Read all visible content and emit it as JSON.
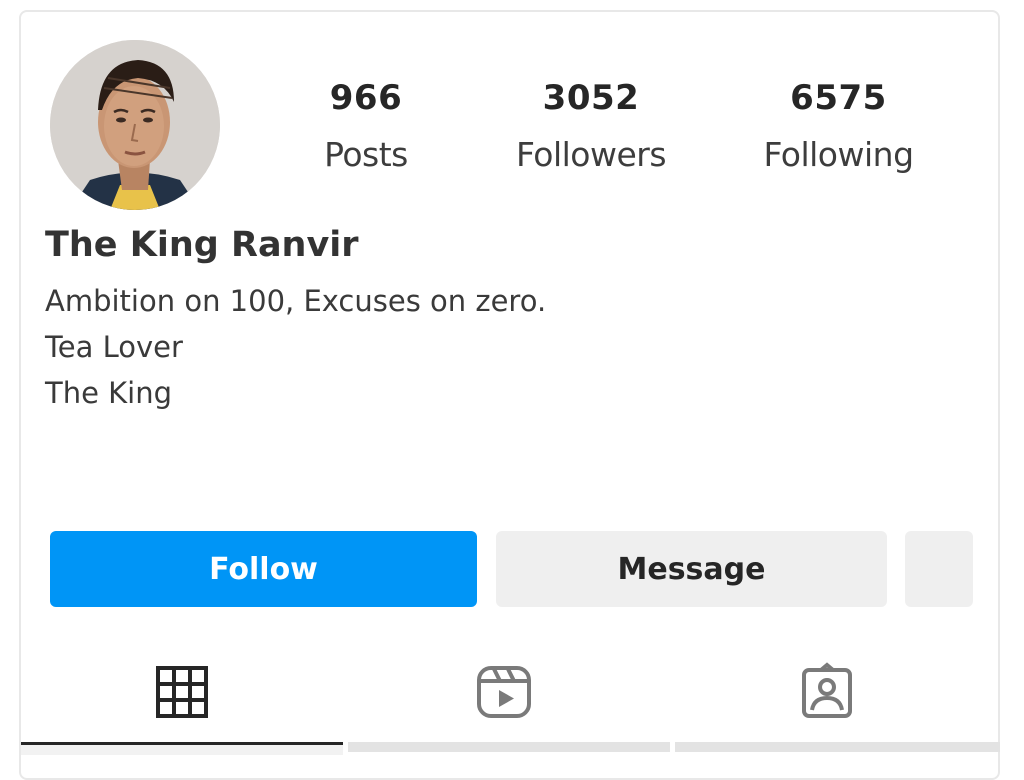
{
  "profile": {
    "name": "The King Ranvir",
    "bio": [
      "Ambition on 100, Excuses on zero.",
      "Tea Lover",
      "The King"
    ]
  },
  "stats": {
    "posts": {
      "count": "966",
      "label": "Posts"
    },
    "followers": {
      "count": "3052",
      "label": "Followers"
    },
    "following": {
      "count": "6575",
      "label": "Following"
    }
  },
  "actions": {
    "follow_label": "Follow",
    "message_label": "Message"
  },
  "tabs": [
    {
      "icon": "grid-icon",
      "active": true
    },
    {
      "icon": "reels-icon",
      "active": false
    },
    {
      "icon": "tagged-icon",
      "active": false
    }
  ],
  "colors": {
    "follow_button": "#0095f6",
    "secondary_button": "#efefef",
    "text": "#262626"
  }
}
